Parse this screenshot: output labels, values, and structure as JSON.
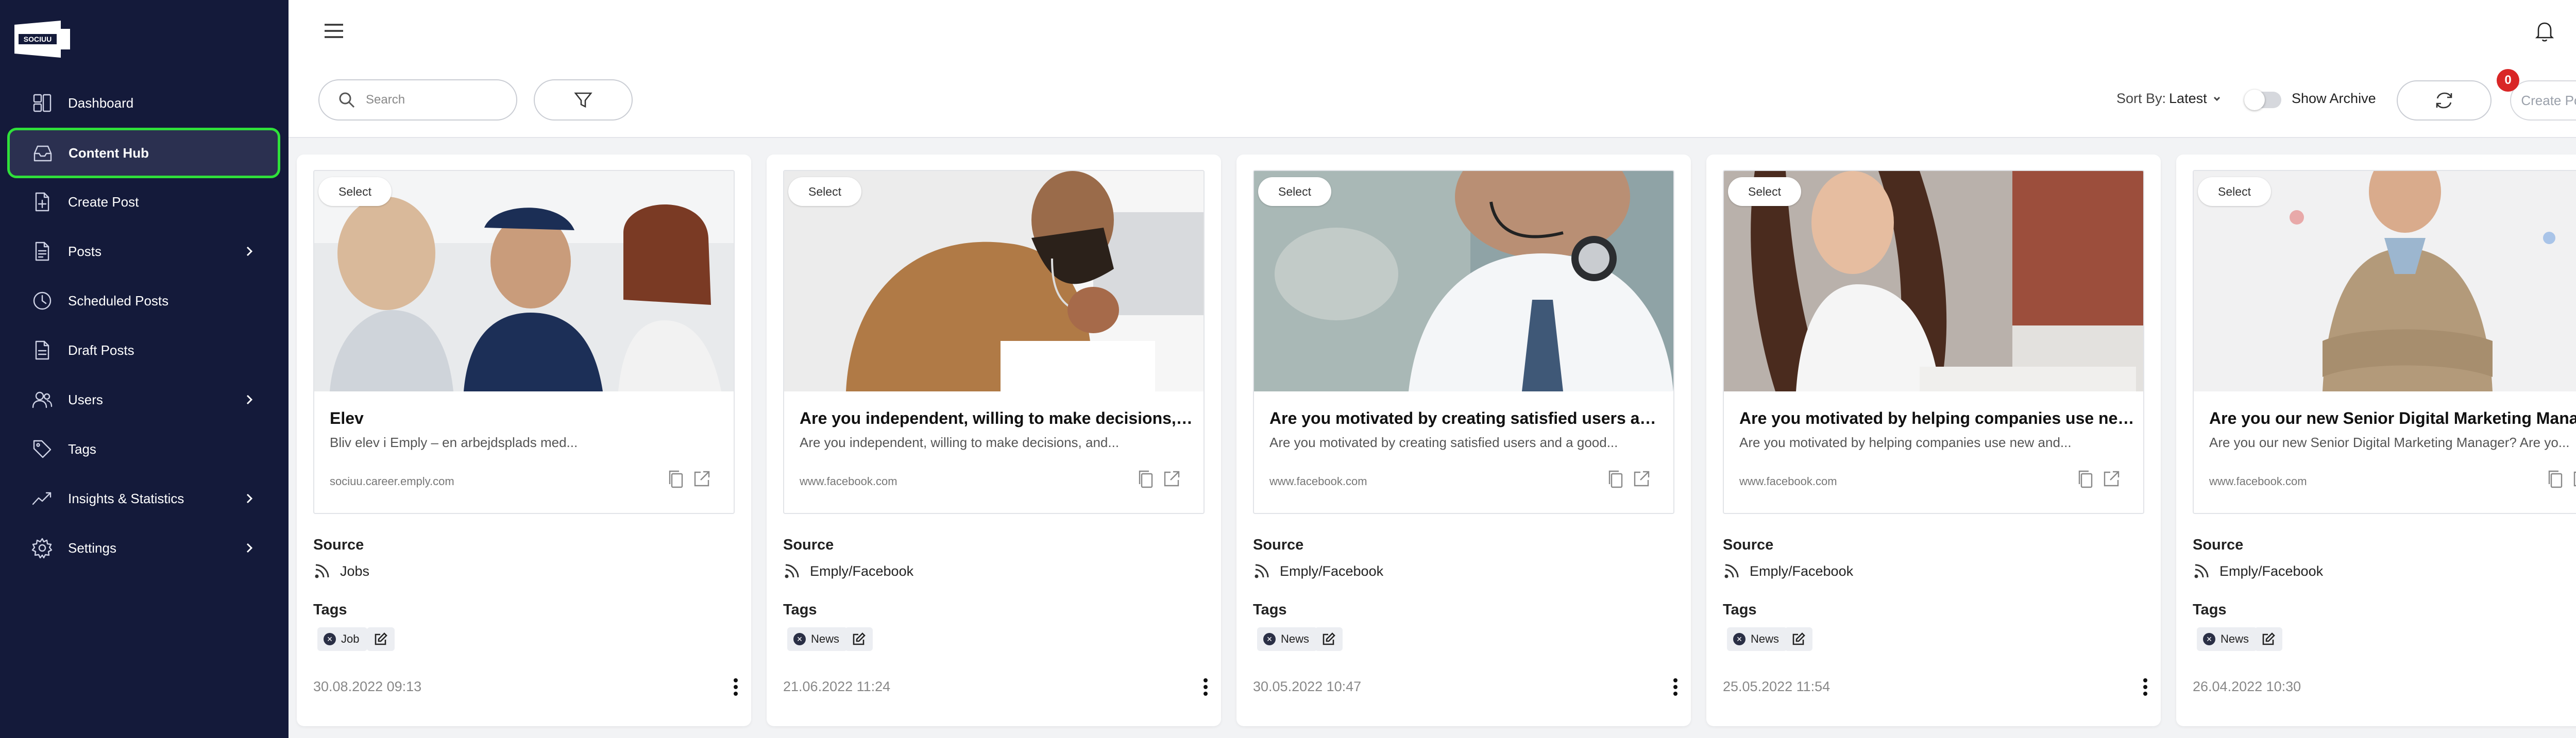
{
  "brand": {
    "logo_text": "SOCIUU",
    "accent": "#2fe03a",
    "sidebar_bg": "#141a3a"
  },
  "sidebar": {
    "items": [
      {
        "label": "Dashboard",
        "icon": "dashboard-icon",
        "active": false,
        "has_children": false
      },
      {
        "label": "Content Hub",
        "icon": "inbox-icon",
        "active": true,
        "has_children": false
      },
      {
        "label": "Create Post",
        "icon": "add-document-icon",
        "active": false,
        "has_children": false
      },
      {
        "label": "Posts",
        "icon": "document-icon",
        "active": false,
        "has_children": true
      },
      {
        "label": "Scheduled Posts",
        "icon": "clock-icon",
        "active": false,
        "has_children": false
      },
      {
        "label": "Draft Posts",
        "icon": "draft-icon",
        "active": false,
        "has_children": false
      },
      {
        "label": "Users",
        "icon": "users-icon",
        "active": false,
        "has_children": true
      },
      {
        "label": "Tags",
        "icon": "tag-icon",
        "active": false,
        "has_children": false
      },
      {
        "label": "Insights & Statistics",
        "icon": "chart-line-icon",
        "active": false,
        "has_children": true
      },
      {
        "label": "Settings",
        "icon": "gear-icon",
        "active": false,
        "has_children": true
      }
    ]
  },
  "toolbar": {
    "search_placeholder": "Search",
    "sort_label": "Sort By:",
    "sort_value": "Latest",
    "archive_label": "Show Archive",
    "archive_on": false,
    "create_post_label": "Create Post",
    "create_post_badge": "0"
  },
  "labels": {
    "select": "Select",
    "source": "Source",
    "tags": "Tags"
  },
  "cards": [
    {
      "title": "Elev",
      "description": "Bliv elev i Emply – en arbejdsplads med...",
      "url": "sociuu.career.emply.com",
      "source": "Jobs",
      "tag": "Job",
      "date": "30.08.2022 09:13"
    },
    {
      "title": "Are you independent, willing to make decisions, an...",
      "description": "Are you independent, willing to make decisions, and...",
      "url": "www.facebook.com",
      "source": "Emply/Facebook",
      "tag": "News",
      "date": "21.06.2022 11:24"
    },
    {
      "title": "Are you motivated by creating satisfied users and ...",
      "description": "Are you motivated by creating satisfied users and a good...",
      "url": "www.facebook.com",
      "source": "Emply/Facebook",
      "tag": "News",
      "date": "30.05.2022 10:47"
    },
    {
      "title": "Are you motivated by helping companies use new...",
      "description": "Are you motivated by helping companies use new and...",
      "url": "www.facebook.com",
      "source": "Emply/Facebook",
      "tag": "News",
      "date": "25.05.2022 11:54"
    },
    {
      "title": "Are you our new Senior Digital Marketing Manager...",
      "description": "Are you our new Senior Digital Marketing Manager? Are yo...",
      "url": "www.facebook.com",
      "source": "Emply/Facebook",
      "tag": "News",
      "date": "26.04.2022 10:30"
    }
  ]
}
